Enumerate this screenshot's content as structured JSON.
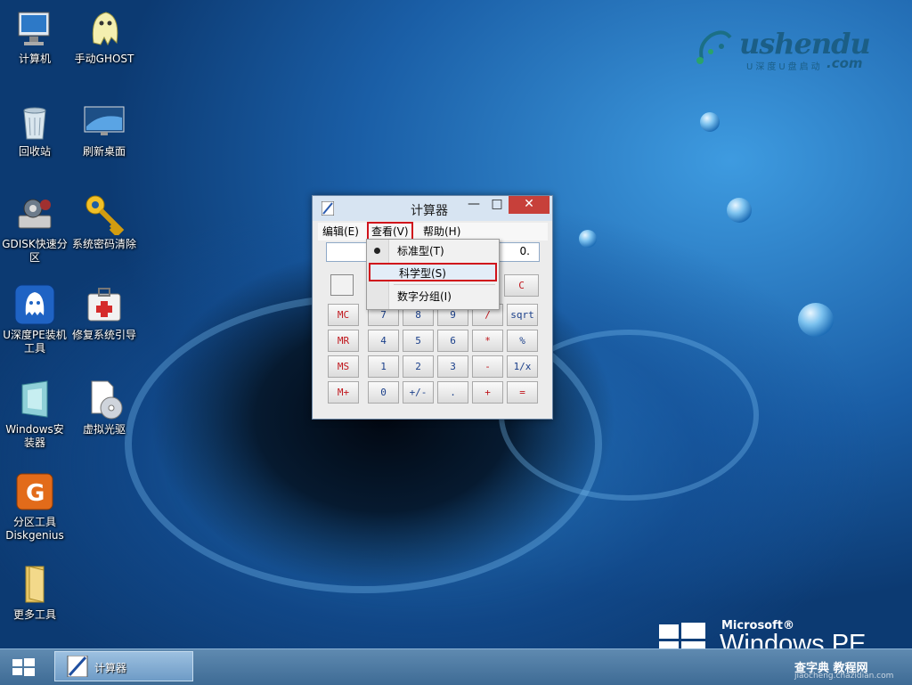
{
  "desktop": {
    "icons": [
      {
        "label": "计算机"
      },
      {
        "label": "手动GHOST"
      },
      {
        "label": "回收站"
      },
      {
        "label": "刷新桌面"
      },
      {
        "label": "GDISK快速分区"
      },
      {
        "label": "系统密码清除"
      },
      {
        "label": "U深度PE装机工具"
      },
      {
        "label": "修复系统引导"
      },
      {
        "label": "Windows安装器"
      },
      {
        "label": "虚拟光驱"
      },
      {
        "label": "分区工具Diskgenius"
      },
      {
        "label": "更多工具"
      }
    ]
  },
  "brand": {
    "name": "ushendu",
    "tagline": "U深度U盘启动",
    "domain": ".com",
    "os_vendor": "Microsoft®",
    "os_name": "Windows PE"
  },
  "calculator": {
    "title": "计算器",
    "window_controls": {
      "minimize": "—",
      "maximize": "□",
      "close": "✕"
    },
    "menus": {
      "edit": "编辑(E)",
      "view": "查看(V)",
      "help": "帮助(H)"
    },
    "display_value": "0.",
    "clear_key": "C",
    "keys": {
      "row1": [
        "MC",
        "7",
        "8",
        "9",
        "/",
        "sqrt"
      ],
      "row2": [
        "MR",
        "4",
        "5",
        "6",
        "*",
        "%"
      ],
      "row3": [
        "MS",
        "1",
        "2",
        "3",
        "-",
        "1/x"
      ],
      "row4": [
        "M+",
        "0",
        "+/-",
        ".",
        "+",
        "="
      ]
    },
    "view_menu": {
      "items": [
        "标准型(T)",
        "科学型(S)",
        "数字分组(I)"
      ],
      "selected": "标准型(T)"
    }
  },
  "taskbar": {
    "task_label": "计算器"
  },
  "watermark": {
    "text": "查字典 教程网",
    "url": "jiaocheng.chazidian.com"
  },
  "colors": {
    "highlight_red": "#d0121b",
    "close_button": "#c7403a",
    "taskbar": "#4a77a2"
  }
}
